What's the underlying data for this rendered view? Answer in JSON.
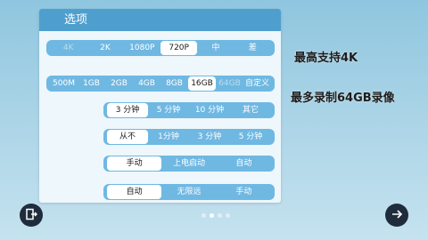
{
  "panel": {
    "title": "选项"
  },
  "resolution": {
    "options": [
      "4K",
      "2K",
      "1080P",
      "720P",
      "中",
      "差"
    ],
    "selected": "720P",
    "disabled": [
      "4K"
    ]
  },
  "storage": {
    "options": [
      "500M",
      "1GB",
      "2GB",
      "4GB",
      "8GB",
      "16GB",
      "64GB",
      "自定义"
    ],
    "selected": "16GB",
    "disabled": [
      "64GB"
    ]
  },
  "segment_length": {
    "options": [
      "3 分钟",
      "5 分钟",
      "10 分钟",
      "其它"
    ],
    "selected": "3 分钟"
  },
  "interval": {
    "options": [
      "从不",
      "1分钟",
      "3 分钟",
      "5 分钟"
    ],
    "selected": "从不"
  },
  "start_mode": {
    "options": [
      "手动",
      "上电启动",
      "自动"
    ],
    "selected": "手动"
  },
  "stop_mode": {
    "options": [
      "自动",
      "无限远",
      "手动"
    ],
    "selected": "自动"
  },
  "info": {
    "max_resolution": "最高支持4K",
    "max_storage": "最多录制64GB录像"
  },
  "pager": {
    "count": 4,
    "active_index": 1
  },
  "icons": {
    "exit": "exit-door-icon",
    "next": "arrow-right-icon"
  },
  "colors": {
    "header": "#4f9fce",
    "segment": "#6fb8e2",
    "selected_bg": "#ffffff"
  }
}
